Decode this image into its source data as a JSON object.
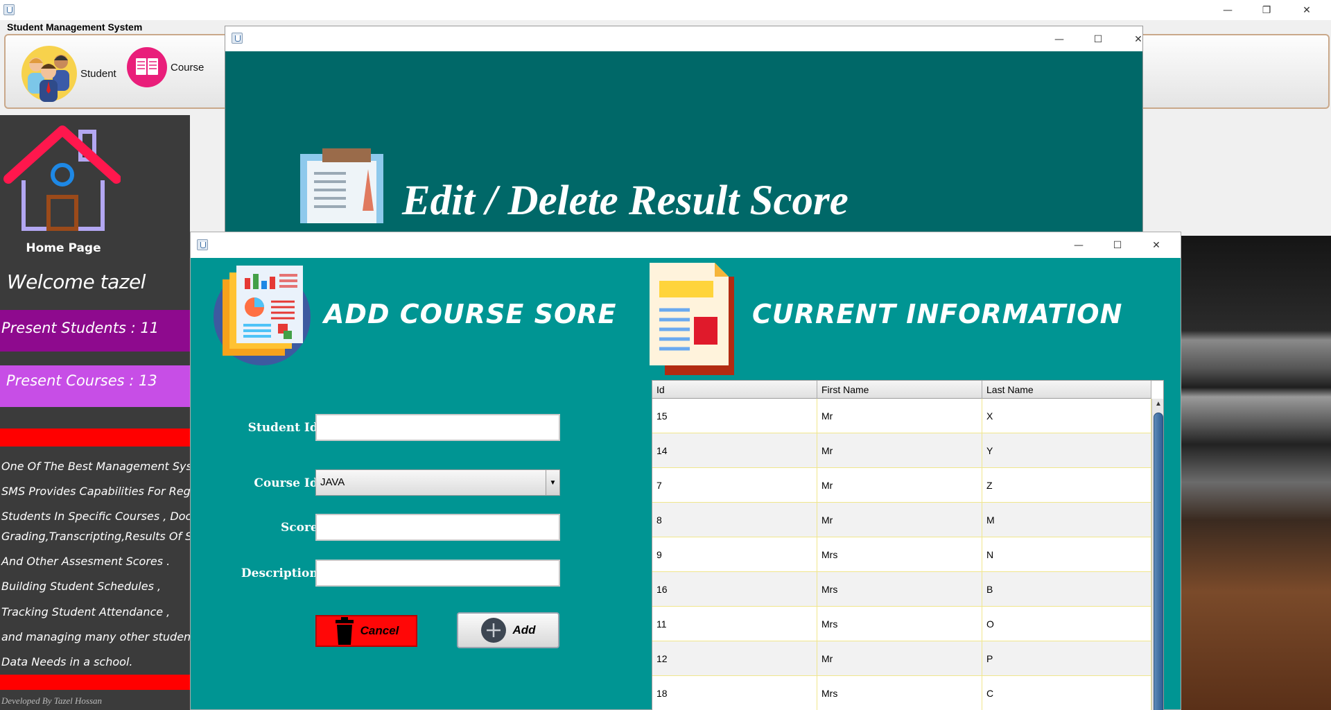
{
  "app": {
    "title": "Student Management System",
    "toolbar": {
      "student_label": "Student",
      "course_label": "Course"
    }
  },
  "window_controls": {
    "minimize": "—",
    "maximize": "☐",
    "close": "✕",
    "restore": "❐"
  },
  "sidebar": {
    "home_label": "Home Page",
    "welcome": "Welcome tazel",
    "present_students": "Present Students : 11",
    "present_courses": "Present Courses : 13",
    "description_lines": [
      "One Of The Best Management Sys",
      "SMS Provides Capabilities For Regi",
      "Students In Specific Courses  , Doc",
      "Grading,Transcripting,Results Of St",
      "And Other Assesment Scores .",
      " Building Student Schedules ,",
      "Tracking Student Attendance ,",
      " and managing many other studen",
      " Data Needs in a school."
    ],
    "developer": "Developed By Tazel Hossan"
  },
  "edit_window": {
    "heading": "Edit / Delete Result Score"
  },
  "add_window": {
    "left_title": "ADD COURSE SORE",
    "right_title": "CURRENT INFORMATION",
    "form": {
      "student_id_label": "Student Id:",
      "student_id_value": "",
      "course_id_label": "Course Id:",
      "course_id_value": "JAVA",
      "score_label": "Score:",
      "score_value": "",
      "description_label": "Description:",
      "description_value": "",
      "cancel_label": "Cancel",
      "add_label": "Add"
    },
    "table": {
      "columns": [
        "Id",
        "First Name",
        "Last Name"
      ],
      "rows": [
        [
          "15",
          "Mr",
          "X"
        ],
        [
          "14",
          "Mr",
          "Y"
        ],
        [
          "7",
          "Mr",
          "Z"
        ],
        [
          "8",
          "Mr",
          "M"
        ],
        [
          "9",
          "Mrs",
          "N"
        ],
        [
          "16",
          "Mrs",
          "B"
        ],
        [
          "11",
          "Mrs",
          "O"
        ],
        [
          "12",
          "Mr",
          "P"
        ],
        [
          "18",
          "Mrs",
          "C"
        ]
      ]
    }
  },
  "colors": {
    "teal": "#009593",
    "dark_teal": "#006868",
    "purple": "#8e0a8e",
    "violet": "#c74ee6",
    "red": "#ff0000"
  }
}
